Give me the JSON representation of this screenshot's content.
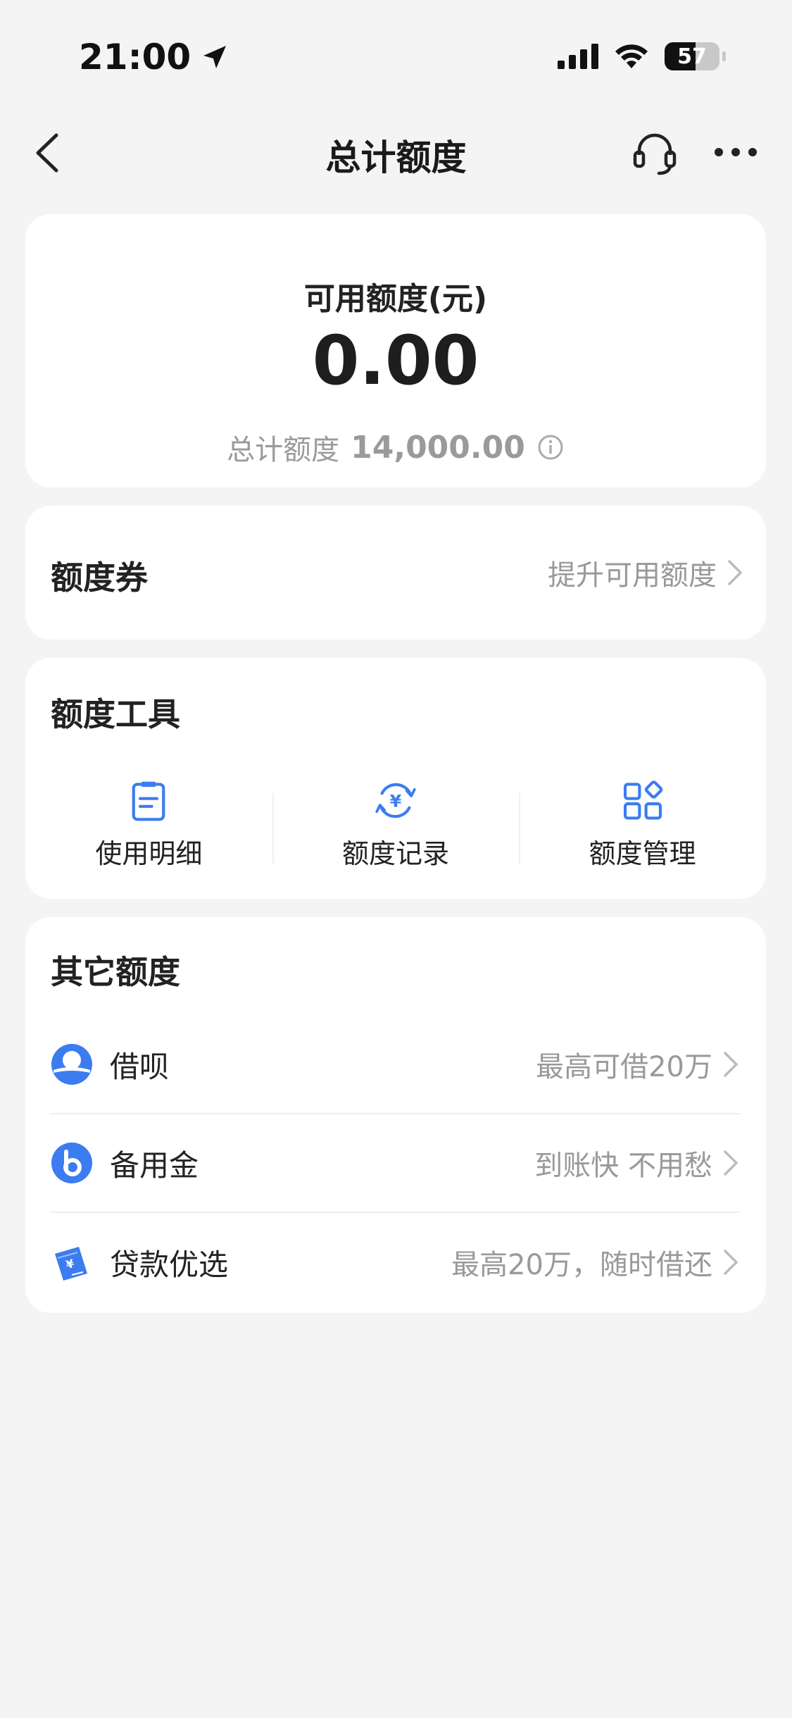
{
  "status_bar": {
    "time": "21:00",
    "battery": "57",
    "battery_level": 0.57
  },
  "nav": {
    "title": "总计额度"
  },
  "balance": {
    "label": "可用额度(元)",
    "value": "0.00",
    "total_label": "总计额度",
    "total_value": "14,000.00"
  },
  "voucher": {
    "title": "额度券",
    "link": "提升可用额度"
  },
  "tools": {
    "title": "额度工具",
    "items": [
      {
        "label": "使用明细",
        "icon": "document-list-icon"
      },
      {
        "label": "额度记录",
        "icon": "yuan-cycle-icon"
      },
      {
        "label": "额度管理",
        "icon": "grid-manage-icon"
      }
    ]
  },
  "other": {
    "title": "其它额度",
    "items": [
      {
        "label": "借呗",
        "desc": "最高可借20万",
        "icon": "jiebei-icon"
      },
      {
        "label": "备用金",
        "desc": "到账快 不用愁",
        "icon": "beiyongjin-icon"
      },
      {
        "label": "贷款优选",
        "desc": "最高20万，随时借还",
        "icon": "loan-ticket-icon"
      }
    ]
  },
  "colors": {
    "accent": "#3b7cf0",
    "background": "#f4f4f4"
  }
}
